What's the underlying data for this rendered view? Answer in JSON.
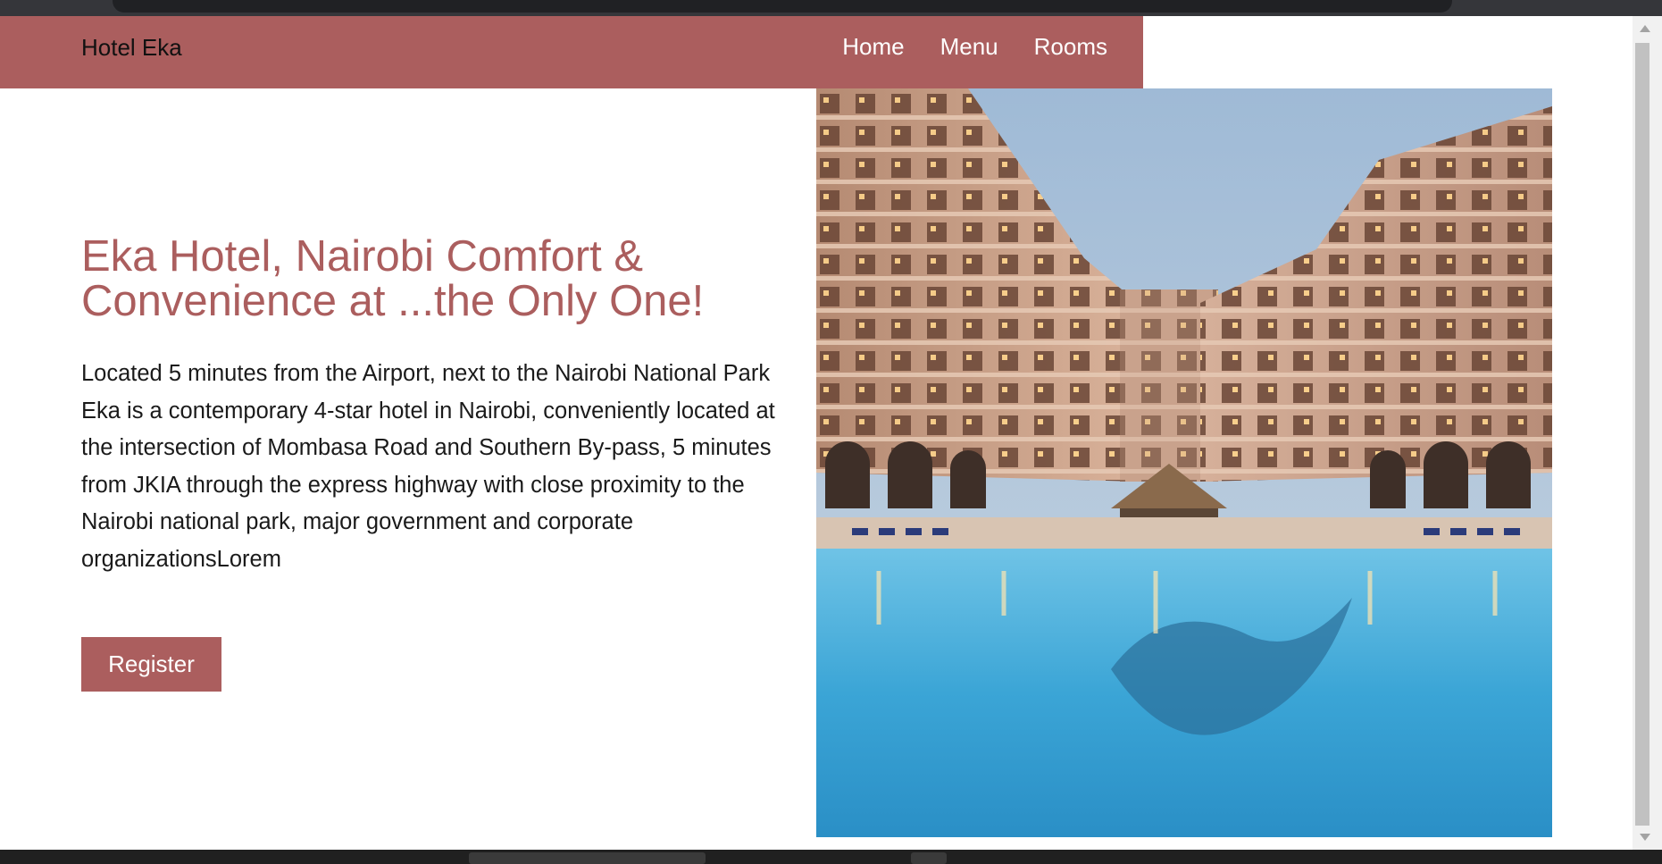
{
  "brand": "Hotel Eka",
  "nav": {
    "items": [
      "Home",
      "Menu",
      "Rooms"
    ]
  },
  "hero": {
    "title": "Eka Hotel, Nairobi Comfort & Convenience at ...the Only One!",
    "paragraph": "Located 5 minutes from the Airport, next to the Nairobi National Park Eka is a contemporary 4-star hotel in Nairobi, conveniently located at the intersection of Mombasa Road and Southern By-pass, 5 minutes from JKIA through the express highway with close proximity to the Nairobi national park, major government and corporate organizationsLorem",
    "register_label": "Register"
  },
  "colors": {
    "accent": "#ab5e5e",
    "pool": "#3ba5d6",
    "sky": "#a9c3da"
  }
}
